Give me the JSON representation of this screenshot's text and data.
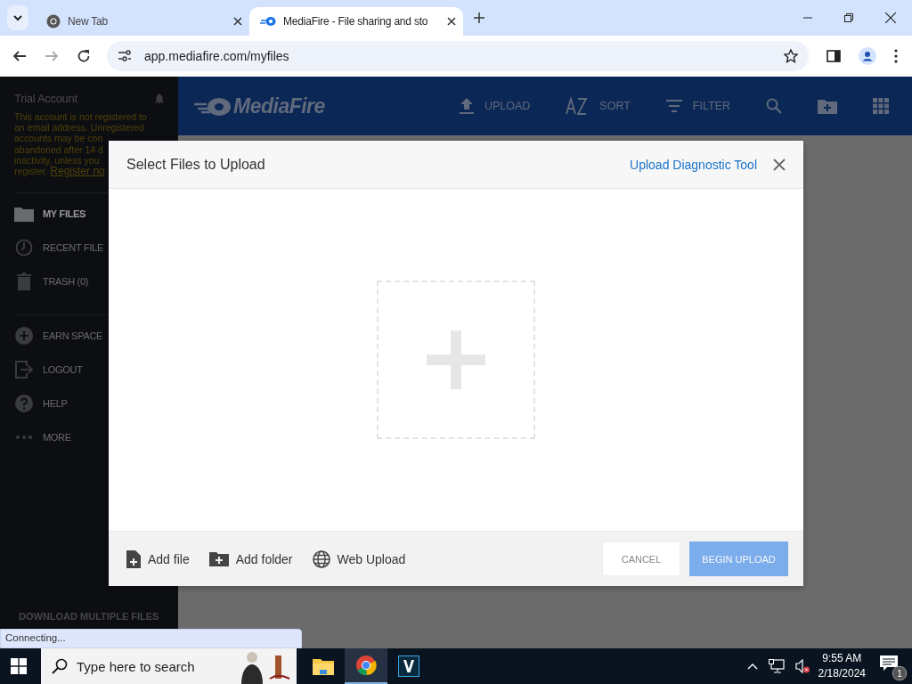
{
  "browser": {
    "tabs": [
      {
        "title": "New Tab",
        "selected": false
      },
      {
        "title": "MediaFire - File sharing and sto",
        "selected": true
      }
    ],
    "url": "app.mediafire.com/myfiles"
  },
  "sidebar": {
    "title": "Trial Account",
    "warning_lines": [
      "This account is not registered to",
      "an email address. Unregistered",
      "accounts may be con",
      "abandoned after 14 d",
      "inactivity, unless you"
    ],
    "warning_last": "register.",
    "register_link": "Register no",
    "items": [
      {
        "label": "MY FILES",
        "selected": true
      },
      {
        "label": "RECENT FILE",
        "selected": false
      },
      {
        "label": "TRASH (0)",
        "selected": false
      },
      {
        "label": "EARN SPACE",
        "selected": false
      },
      {
        "label": "LOGOUT",
        "selected": false
      },
      {
        "label": "HELP",
        "selected": false
      },
      {
        "label": "MORE",
        "selected": false
      }
    ],
    "promo": "DOWNLOAD MULTIPLE FILES"
  },
  "header": {
    "logo": "MediaFire",
    "actions": [
      "UPLOAD",
      "SORT",
      "FILTER"
    ]
  },
  "dialog": {
    "title": "Select Files to Upload",
    "link": "Upload Diagnostic Tool",
    "add_actions": [
      "Add file",
      "Add folder",
      "Web Upload"
    ],
    "buttons": [
      {
        "label": "CANCEL",
        "kind": "secondary",
        "disabled": false
      },
      {
        "label": "BEGIN UPLOAD",
        "kind": "primary",
        "disabled": true
      }
    ]
  },
  "status": "Connecting...",
  "taskbar": {
    "search_placeholder": "Type here to search",
    "apps": [
      {
        "selected": false
      },
      {
        "selected": true
      },
      {
        "selected": false
      }
    ],
    "time": "9:55 AM",
    "date": "2/18/2024",
    "notifications": "1"
  }
}
